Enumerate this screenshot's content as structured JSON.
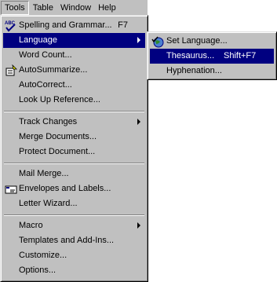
{
  "menubar": {
    "items": [
      {
        "label": "Tools",
        "active": true
      },
      {
        "label": "Table",
        "active": false
      },
      {
        "label": "Window",
        "active": false
      },
      {
        "label": "Help",
        "active": false
      }
    ]
  },
  "tools_menu": {
    "items": [
      {
        "label": "Spelling and Grammar...",
        "shortcut": "F7",
        "icon": "spelling-abc-check-icon"
      },
      {
        "label": "Language",
        "submenu": true,
        "highlighted": true
      },
      {
        "label": "Word Count..."
      },
      {
        "label": "AutoSummarize...",
        "icon": "autosummarize-icon"
      },
      {
        "label": "AutoCorrect..."
      },
      {
        "label": "Look Up Reference..."
      },
      {
        "label": "Track Changes",
        "submenu": true
      },
      {
        "label": "Merge Documents..."
      },
      {
        "label": "Protect Document..."
      },
      {
        "label": "Mail Merge..."
      },
      {
        "label": "Envelopes and Labels...",
        "icon": "envelope-icon"
      },
      {
        "label": "Letter Wizard..."
      },
      {
        "label": "Macro",
        "submenu": true
      },
      {
        "label": "Templates and Add-Ins..."
      },
      {
        "label": "Customize..."
      },
      {
        "label": "Options..."
      }
    ]
  },
  "language_submenu": {
    "items": [
      {
        "label": "Set Language...",
        "icon": "globe-check-icon"
      },
      {
        "label": "Thesaurus...",
        "shortcut": "Shift+F7",
        "highlighted": true
      },
      {
        "label": "Hyphenation..."
      }
    ]
  },
  "colors": {
    "menu_face": "#c0c0c0",
    "highlight": "#000080",
    "highlight_text": "#ffffff"
  }
}
